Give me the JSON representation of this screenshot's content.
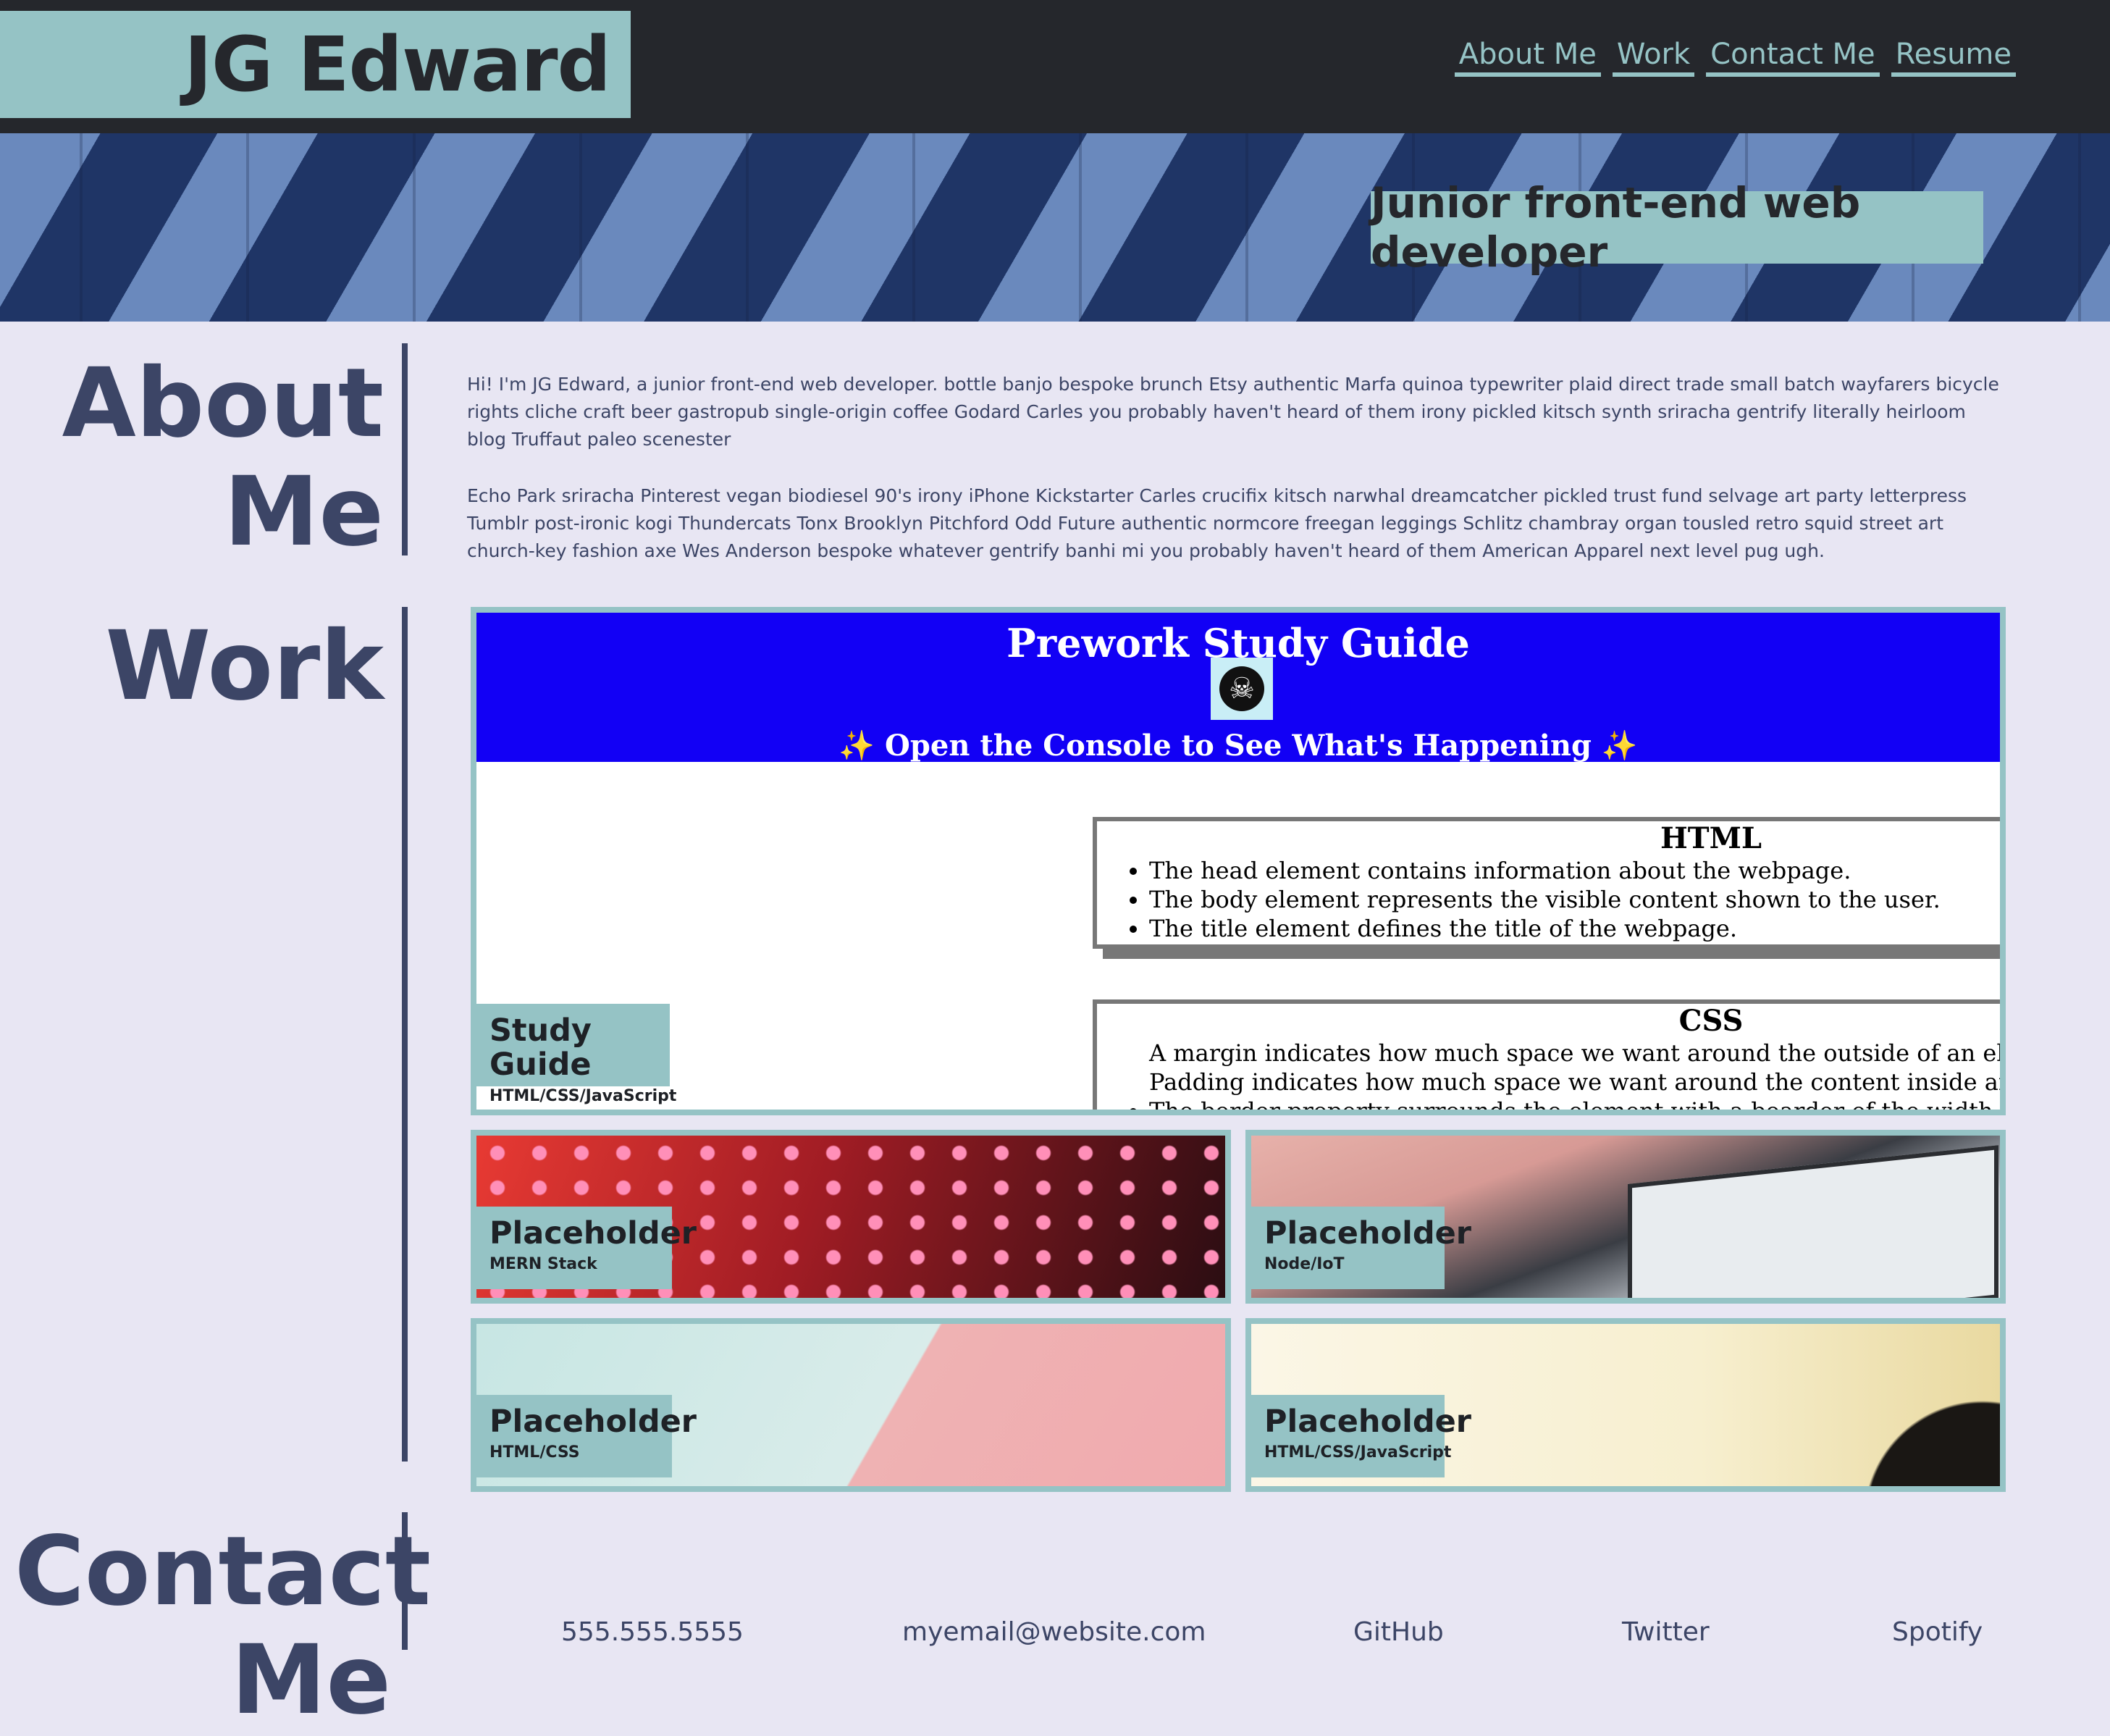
{
  "header": {
    "brand": "JG Edward",
    "nav": [
      "About Me",
      "Work",
      "Contact Me",
      "Resume"
    ]
  },
  "hero": {
    "tagline": "Junior front-end web developer"
  },
  "about": {
    "title_line1": "About",
    "title_line2": "Me",
    "paragraphs": [
      "Hi! I'm JG Edward, a junior front-end web developer. bottle banjo bespoke brunch Etsy authentic Marfa quinoa typewriter plaid direct trade small batch wayfarers bicycle rights cliche craft beer gastropub single-origin coffee Godard Carles you probably haven't heard of them irony pickled kitsch synth sriracha gentrify literally heirloom blog Truffaut paleo scenester",
      "Echo Park sriracha Pinterest vegan biodiesel 90's irony iPhone Kickstarter Carles crucifix kitsch narwhal dreamcatcher pickled trust fund selvage art party letterpress Tumblr post-ironic kogi Thundercats Tonx Brooklyn Pitchford Odd Future authentic normcore freegan leggings Schlitz chambray organ tousled retro squid street art church-key fashion axe Wes Anderson bespoke whatever gentrify banhi mi you probably haven't heard of them American Apparel next level pug ugh."
    ]
  },
  "work": {
    "title": "Work",
    "featured": {
      "screenshot": {
        "title": "Prework Study Guide",
        "subtitle": "✨ Open the Console to See What's Happening ✨",
        "html_heading": "HTML",
        "html_items": [
          "The head element contains information about the webpage.",
          "The body element represents the visible content shown to the user.",
          "The title element defines the title of the webpage."
        ],
        "css_heading": "CSS",
        "css_lines": [
          "A margin indicates how much space we want around the outside of an element.",
          "Padding indicates how much space we want around the content inside an element."
        ],
        "css_items": [
          "The border property surrounds the element with a boarder of the width, colour, and line type specified."
        ]
      },
      "label": "Study Guide",
      "tech": "HTML/CSS/JavaScript"
    },
    "projects": [
      {
        "label": "Placeholder",
        "tech": "MERN Stack"
      },
      {
        "label": "Placeholder",
        "tech": "Node/IoT"
      },
      {
        "label": "Placeholder",
        "tech": "HTML/CSS"
      },
      {
        "label": "Placeholder",
        "tech": "HTML/CSS/JavaScript"
      }
    ]
  },
  "contact": {
    "title_line1": "Contact",
    "title_line2": "Me",
    "links": [
      "555.555.5555",
      "myemail@website.com",
      "GitHub",
      "Twitter",
      "Spotify"
    ]
  },
  "colors": {
    "page_bg": "#e8e6f3",
    "topbar": "#25272c",
    "accent": "#95c3c5",
    "heading": "#3c4566",
    "study_guide_header": "#1200f5"
  }
}
